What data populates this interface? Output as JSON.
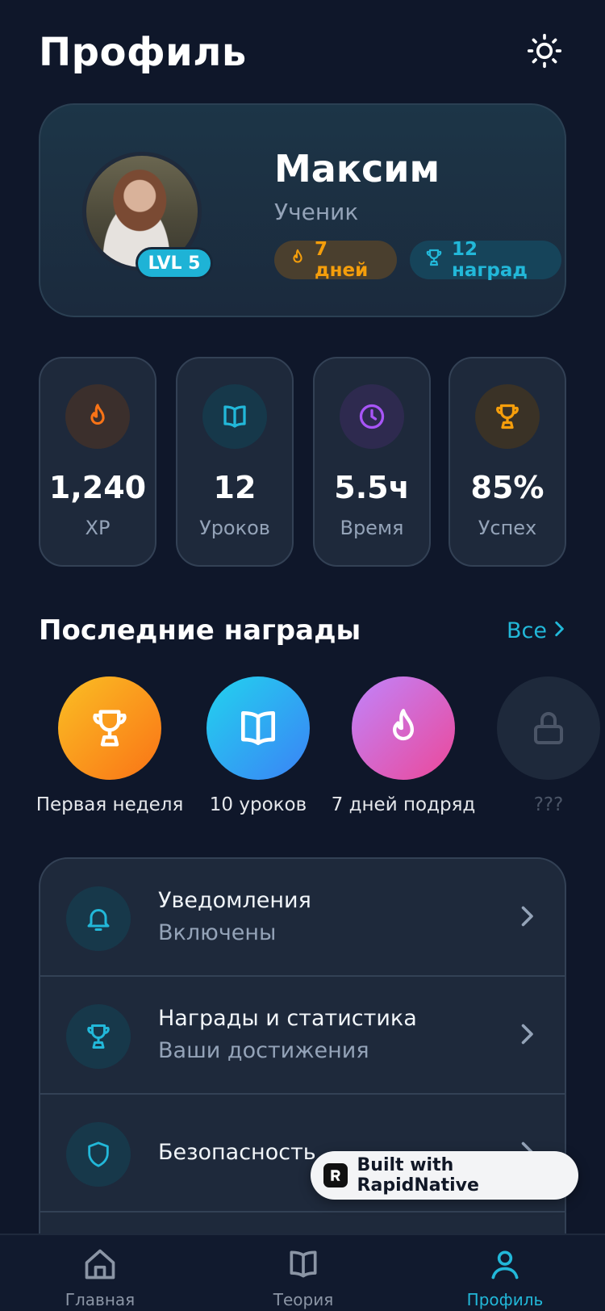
{
  "header": {
    "title": "Профиль",
    "theme_icon": "sun-icon"
  },
  "profile": {
    "name": "Максим",
    "role": "Ученик",
    "level": "LVL 5",
    "streak": "7 дней",
    "awards": "12 наград",
    "colors": {
      "accent": "#22b8d9",
      "streak": "#f59e0b"
    }
  },
  "stats": [
    {
      "value": "1,240",
      "label": "XP",
      "icon": "flame-icon",
      "color": "#f97316"
    },
    {
      "value": "12",
      "label": "Уроков",
      "icon": "book-icon",
      "color": "#22b8d9"
    },
    {
      "value": "5.5ч",
      "label": "Время",
      "icon": "clock-icon",
      "color": "#a855f7"
    },
    {
      "value": "85%",
      "label": "Успех",
      "icon": "trophy-icon",
      "color": "#f59e0b"
    }
  ],
  "recent_awards": {
    "title": "Последние награды",
    "see_all": "Все",
    "items": [
      {
        "label": "Первая неделя",
        "icon": "trophy-icon"
      },
      {
        "label": "10 уроков",
        "icon": "book-icon"
      },
      {
        "label": "7 дней подряд",
        "icon": "flame-icon"
      },
      {
        "label": "???",
        "icon": "lock-icon"
      }
    ]
  },
  "menu": [
    {
      "title": "Уведомления",
      "subtitle": "Включены",
      "icon": "bell-icon"
    },
    {
      "title": "Награды и статистика",
      "subtitle": "Ваши достижения",
      "icon": "trophy-icon"
    },
    {
      "title": "Безопасность",
      "icon": "shield-icon"
    }
  ],
  "built_with": "Built with RapidNative",
  "tabbar": [
    {
      "label": "Главная",
      "icon": "home-icon"
    },
    {
      "label": "Теория",
      "icon": "book-icon"
    },
    {
      "label": "Профиль",
      "icon": "user-icon",
      "active": true
    }
  ]
}
